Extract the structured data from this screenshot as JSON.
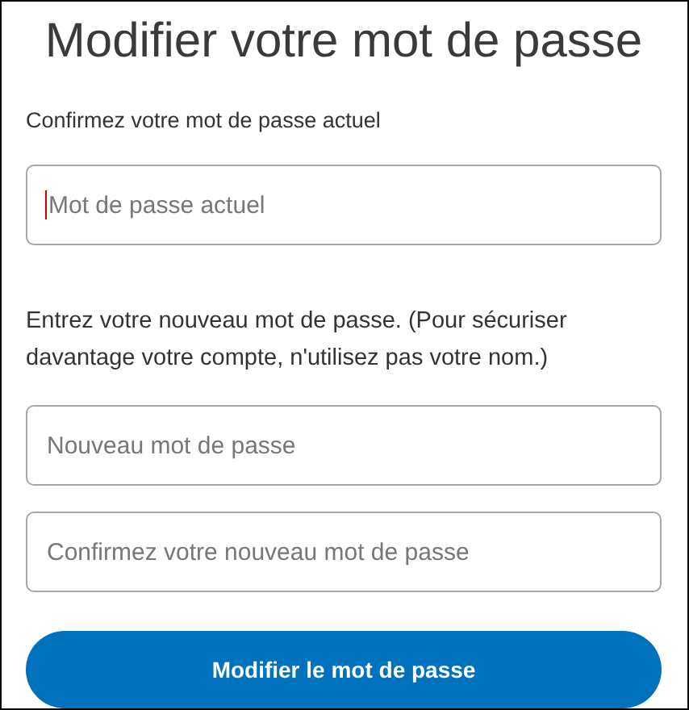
{
  "title": "Modifier votre mot de passe",
  "current_label": "Confirmez votre mot de passe actuel",
  "current_field": {
    "placeholder": "Mot de passe actuel",
    "focused": true
  },
  "new_instructions": "Entrez votre nouveau mot de passe. (Pour sécuriser davantage votre compte, n'utilisez pas votre nom.)",
  "new_fields": [
    {
      "placeholder": "Nouveau mot de passe",
      "focused": false
    },
    {
      "placeholder": "Confirmez votre nouveau mot de passe",
      "focused": false
    }
  ],
  "submit_button": "Modifier le mot de passe"
}
